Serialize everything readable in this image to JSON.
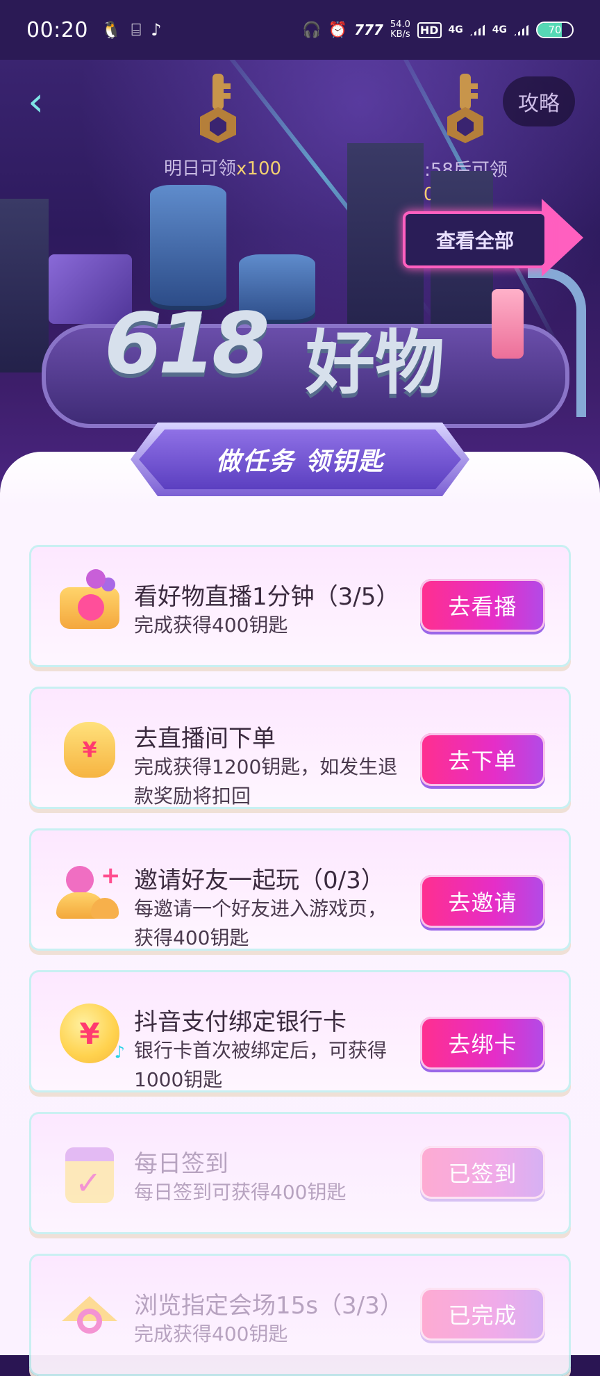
{
  "status_bar": {
    "time": "00:20",
    "left_icons": [
      "qq-icon",
      "translate-icon",
      "tiktok-icon"
    ],
    "net_speed_value": "54.0",
    "net_speed_unit": "KB/s",
    "hd_badge": "HD",
    "network_1": "4G",
    "network_2": "4G",
    "battery": "70",
    "battery_level": 0.7
  },
  "hero": {
    "guide_label": "攻略",
    "key1_label": "明日可领",
    "key1_mult": "x100",
    "key2_label": "20:58后可领",
    "key2_mult": "x50",
    "view_all_label": "查看全部",
    "logo_618": "618",
    "logo_text": "好物"
  },
  "banner": {
    "title": "做任务 领钥匙"
  },
  "tasks": [
    {
      "title": "看好物直播1分钟（3/5）",
      "desc": "完成获得400钥匙",
      "button": "去看播"
    },
    {
      "title": "去直播间下单",
      "desc": "完成获得1200钥匙，如发生退款奖励将扣回",
      "button": "去下单"
    },
    {
      "title": "邀请好友一起玩（0/3）",
      "desc": "每邀请一个好友进入游戏页，获得400钥匙",
      "button": "去邀请"
    },
    {
      "title": "抖音支付绑定银行卡",
      "desc": "银行卡首次被绑定后，可获得1000钥匙",
      "button": "去绑卡"
    },
    {
      "title": "每日签到",
      "desc": "每日签到可获得400钥匙",
      "button": "已签到"
    },
    {
      "title": "浏览指定会场15s（3/3）",
      "desc": "完成获得400钥匙",
      "button": "已完成"
    }
  ],
  "colors": {
    "button_gradient_start": "#ff2f8e",
    "button_gradient_end": "#b14be8",
    "key_multiplier": "#f2cf70"
  }
}
